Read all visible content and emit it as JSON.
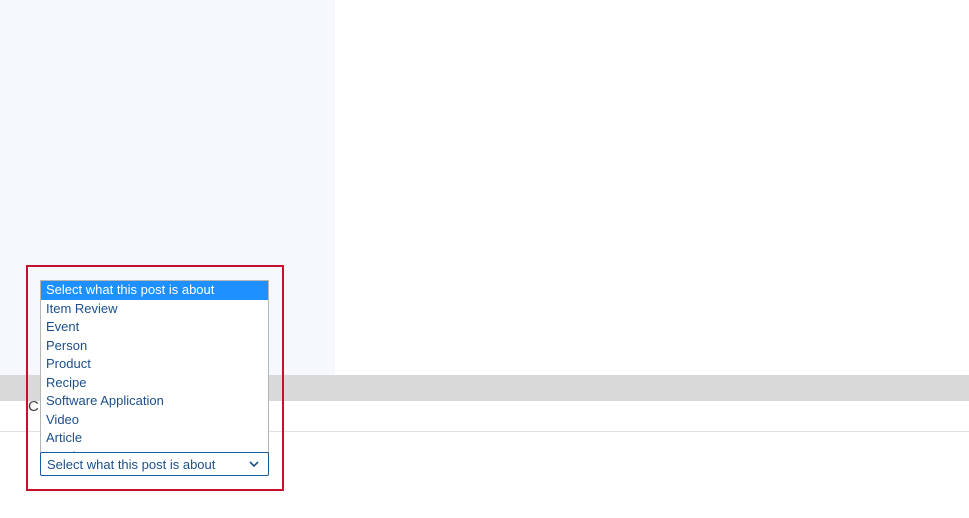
{
  "background": {
    "partial_char": "C"
  },
  "dropdown": {
    "placeholder": "Select what this post is about",
    "selected_index": 0,
    "options": [
      "Select what this post is about",
      "Item Review",
      "Event",
      "Person",
      "Product",
      "Recipe",
      "Software Application",
      "Video",
      "Article",
      "Service"
    ]
  },
  "colors": {
    "highlight_border": "#c5112e",
    "option_text": "#1d4f8b",
    "option_selected_bg": "#1e90ff",
    "option_selected_text": "#ffffff",
    "combobox_border": "#1a5a9e",
    "left_panel_bg": "#f5f8fc",
    "grey_band_bg": "#d9d9d9"
  }
}
